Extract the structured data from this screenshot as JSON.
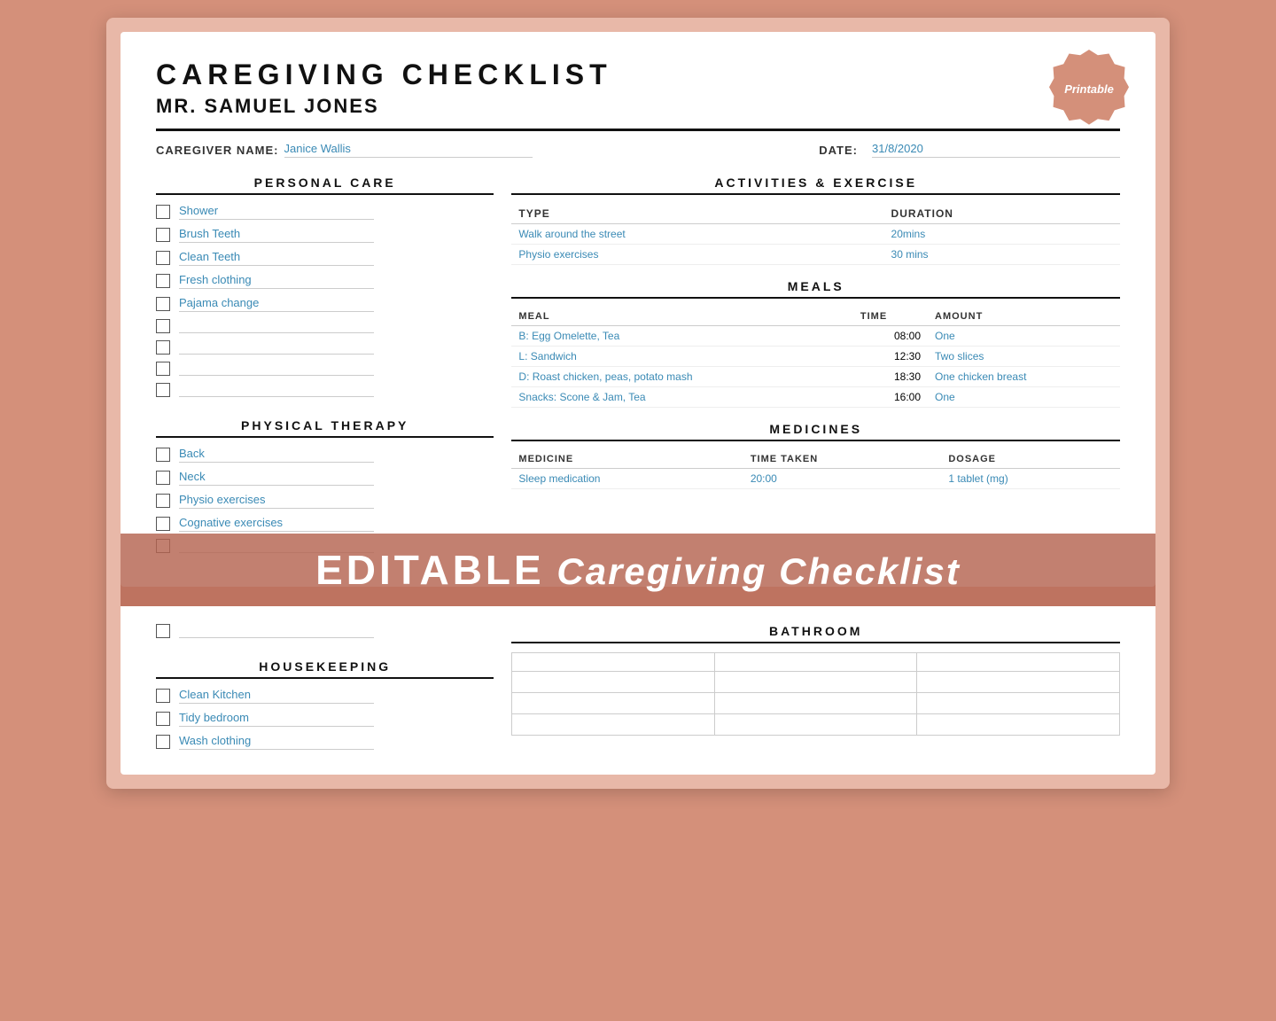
{
  "header": {
    "title": "CAREGIVING CHECKLIST",
    "subtitle": "MR. SAMUEL JONES",
    "printable_badge": "Printable",
    "caregiver_label": "CAREGIVER NAME:",
    "caregiver_value": "Janice Wallis",
    "date_label": "DATE:",
    "date_value": "31/8/2020"
  },
  "personal_care": {
    "section_title": "PERSONAL CARE",
    "items": [
      "Shower",
      "Brush Teeth",
      "Clean Teeth",
      "Fresh clothing",
      "Pajama change"
    ],
    "empty_items": 4
  },
  "physical_therapy": {
    "section_title": "PHYSICAL THERAPY",
    "items": [
      "Back",
      "Neck",
      "Physio exercises",
      "Cognative exercises"
    ],
    "empty_items": 1
  },
  "housekeeping": {
    "section_title": "HOUSEKEEPING",
    "items": [
      "Clean Kitchen",
      "Tidy bedroom",
      "Wash clothing"
    ]
  },
  "activities": {
    "section_title": "ACTIVITIES & EXERCISE",
    "col_type": "TYPE",
    "col_duration": "DURATION",
    "rows": [
      {
        "type": "Walk around the street",
        "duration": "20mins"
      },
      {
        "type": "Physio exercises",
        "duration": "30 mins"
      }
    ]
  },
  "meals": {
    "section_title": "MEALS",
    "col_meal": "MEAL",
    "col_time": "TIME",
    "col_amount": "AMOUNT",
    "rows": [
      {
        "meal": "B: Egg Omelette, Tea",
        "time": "08:00",
        "amount": "One"
      },
      {
        "meal": "L: Sandwich",
        "time": "12:30",
        "amount": "Two slices"
      },
      {
        "meal": "D: Roast chicken, peas, potato mash",
        "time": "18:30",
        "amount": "One chicken breast"
      },
      {
        "meal": "Snacks: Scone & Jam, Tea",
        "time": "16:00",
        "amount": "One"
      }
    ]
  },
  "medicines": {
    "section_title": "MEDICINES",
    "col_medicine": "MEDICINE",
    "col_time_taken": "TIME TAKEN",
    "col_dosage": "DOSAGE",
    "rows": [
      {
        "medicine": "Sleep medication",
        "time_taken": "20:00",
        "dosage": "1 tablet (mg)"
      }
    ]
  },
  "bathroom": {
    "section_title": "BATHROOM",
    "col_headers": [
      "",
      "",
      ""
    ]
  },
  "banner": {
    "editable_text": "EDITABLE",
    "rest_text": " Caregiving Checklist"
  },
  "bottom_extra_checkbox": "blank"
}
